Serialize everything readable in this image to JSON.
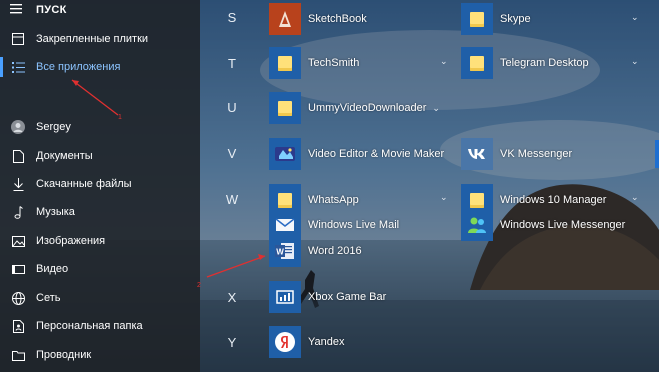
{
  "sidebar": {
    "title": "ПУСК",
    "items": [
      {
        "label": "Закрепленные плитки",
        "icon": "tiles-icon"
      },
      {
        "label": "Все приложения",
        "icon": "list-icon"
      },
      {
        "label": "Sergey",
        "icon": "avatar-icon"
      },
      {
        "label": "Документы",
        "icon": "document-icon"
      },
      {
        "label": "Скачанные файлы",
        "icon": "download-icon"
      },
      {
        "label": "Музыка",
        "icon": "music-icon"
      },
      {
        "label": "Изображения",
        "icon": "picture-icon"
      },
      {
        "label": "Видео",
        "icon": "video-icon"
      },
      {
        "label": "Сеть",
        "icon": "network-icon"
      },
      {
        "label": "Персональная папка",
        "icon": "user-folder-icon"
      },
      {
        "label": "Проводник",
        "icon": "explorer-icon"
      }
    ]
  },
  "letters": {
    "s": "S",
    "t": "T",
    "u": "U",
    "v": "V",
    "w": "W",
    "x": "X",
    "y": "Y"
  },
  "apps": {
    "sketchbook": "SketchBook",
    "skype": "Skype",
    "techsmith": "TechSmith",
    "telegram": "Telegram Desktop",
    "ummy": "UmmyVideoDownloader",
    "video_editor": "Video Editor & Movie Maker",
    "vk": "VK Messenger",
    "whatsapp": "WhatsApp",
    "win10manager": "Windows 10 Manager",
    "wlmail": "Windows Live Mail",
    "wlmessenger": "Windows Live Messenger",
    "word": "Word 2016",
    "xbox": "Xbox Game Bar",
    "yandex": "Yandex"
  },
  "annotations": {
    "one": "1",
    "two": "2"
  },
  "colors": {
    "accent": "#4aa0ff",
    "tile_blue": "#1f5fa8",
    "annotation": "#e03030"
  }
}
